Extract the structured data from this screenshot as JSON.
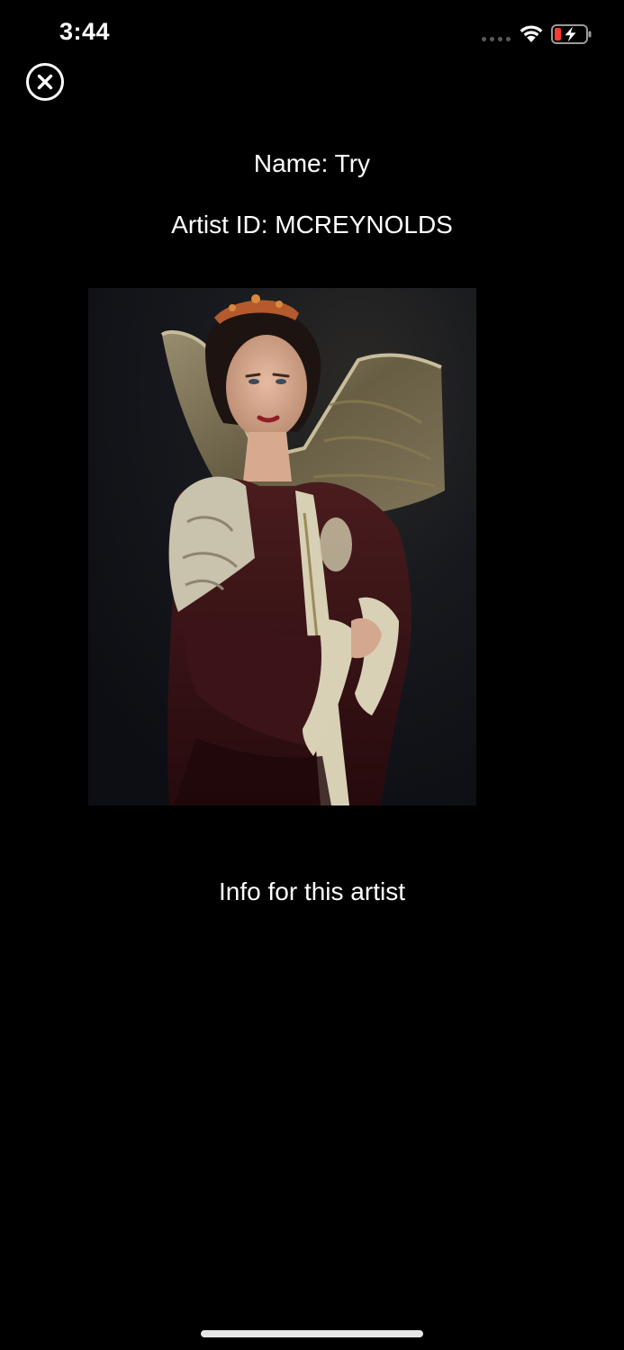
{
  "status_bar": {
    "time": "3:44",
    "icons": [
      "cellular-signal-icon",
      "wifi-icon",
      "battery-charging-icon"
    ],
    "battery_color": "#ff3b30"
  },
  "close_button": {
    "icon": "close-icon"
  },
  "artist": {
    "name_text": "Name: Try",
    "artist_id_text": "Artist ID: MCREYNOLDS",
    "info_text": "Info for this artist"
  },
  "artwork": {
    "subject": "portrait-of-woman-in-renaissance-costume"
  },
  "colors": {
    "background": "#000000",
    "text": "#ffffff"
  }
}
